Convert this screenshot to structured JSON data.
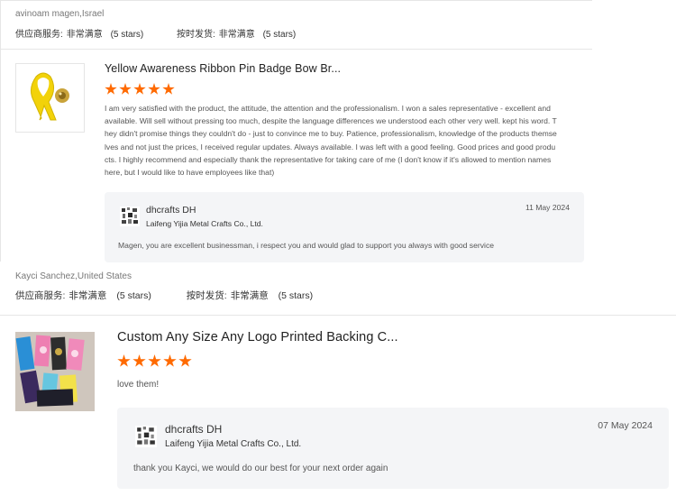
{
  "reviews": [
    {
      "reviewer": "avinoam magen,Israel",
      "supplier_service_label": "供应商服务:",
      "supplier_service_value": "非常满意",
      "supplier_service_stars": "(5 stars)",
      "shipping_label": "按时发货:",
      "shipping_value": "非常满意",
      "shipping_stars": "(5 stars)",
      "product_title": "Yellow Awareness Ribbon Pin Badge Bow Br...",
      "rating": 5,
      "text": "I am very satisfied with the product, the attitude, the attention and the professionalism.  I won a sales representative - excellent and available.  Will sell without pressing too much, despite the language differences we understood each other very well.  kept his word.  They didn't promise things they couldn't do - just to convince me to buy.  Patience, professionalism, knowledge of the products themselves and not just the prices, I received regular updates.  Always available.  I was left with a good feeling.  Good prices and good products.  I highly recommend and especially thank the representative for taking care of me (I don't know if it's allowed to mention names here, but I would like to have employees like that)",
      "reply": {
        "seller": "dhcrafts DH",
        "company": "Laifeng Yijia Metal Crafts Co., Ltd.",
        "date": "11 May 2024",
        "text": "Magen, you are excellent businessman, i respect you and would glad to support you always with good service"
      }
    },
    {
      "reviewer": "Kayci Sanchez,United States",
      "supplier_service_label": "供应商服务:",
      "supplier_service_value": "非常满意",
      "supplier_service_stars": "(5 stars)",
      "shipping_label": "按时发货:",
      "shipping_value": "非常满意",
      "shipping_stars": "(5 stars)",
      "product_title": "Custom Any Size Any Logo Printed Backing C...",
      "rating": 5,
      "text": "love them!",
      "reply": {
        "seller": "dhcrafts DH",
        "company": "Laifeng Yijia Metal Crafts Co., Ltd.",
        "date": "07 May 2024",
        "text": "thank you Kayci, we  would do our best for your next order again"
      }
    }
  ],
  "colors": {
    "star": "#ff6a00",
    "reply_bg": "#f4f5f7",
    "ribbon_yellow": "#f2d20a"
  },
  "icons": {
    "star": "star-icon",
    "seller_logo": "seller-logo-icon"
  }
}
